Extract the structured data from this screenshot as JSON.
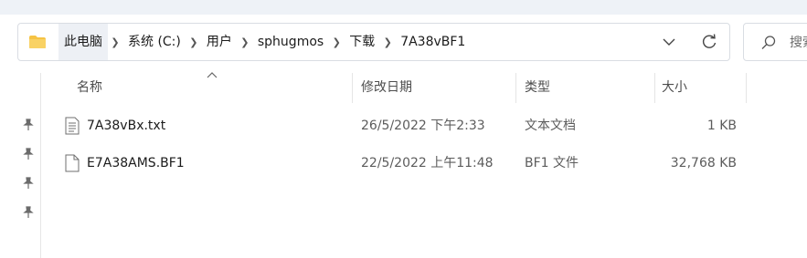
{
  "address_bar": {
    "breadcrumbs": [
      "此电脑",
      "系统 (C:)",
      "用户",
      "sphugmos",
      "下载",
      "7A38vBF1"
    ]
  },
  "search": {
    "placeholder": "搜索"
  },
  "columns": {
    "name": "名称",
    "modified": "修改日期",
    "type": "类型",
    "size": "大小"
  },
  "files": [
    {
      "name": "7A38vBx.txt",
      "modified": "26/5/2022 下午2:33",
      "type": "文本文档",
      "size": "1 KB",
      "icon": "text-file-icon"
    },
    {
      "name": "E7A38AMS.BF1",
      "modified": "22/5/2022 上午11:48",
      "type": "BF1 文件",
      "size": "32,768 KB",
      "icon": "blank-file-icon"
    }
  ],
  "colors": {
    "folder": "#f6c343",
    "border": "#d9dde3",
    "crumb_hover": "#edf0f5"
  }
}
